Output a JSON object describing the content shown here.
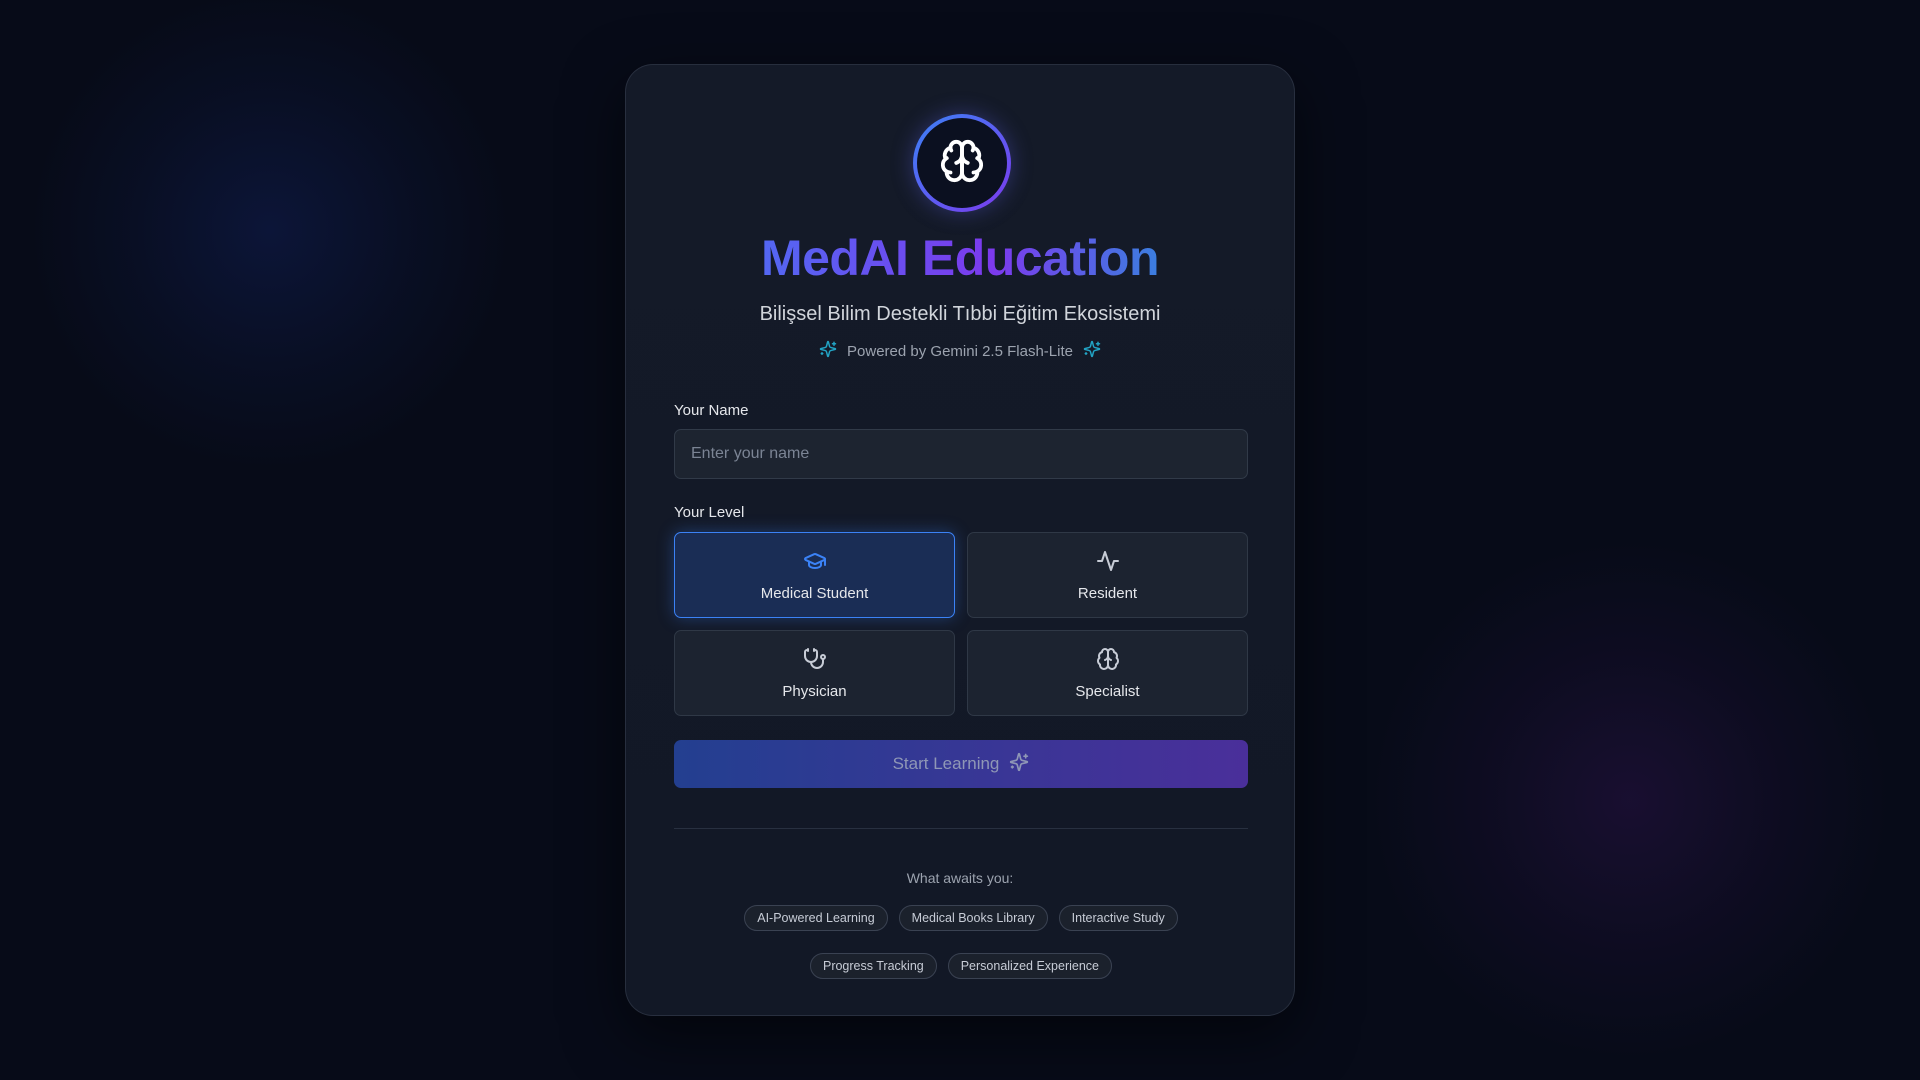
{
  "app": {
    "title": "MedAI Education",
    "subtitle": "Bilişsel Bilim Destekli Tıbbi Eğitim Ekosistemi",
    "powered_by": "Powered by Gemini 2.5 Flash-Lite"
  },
  "form": {
    "name_label": "Your Name",
    "name_placeholder": "Enter your name",
    "name_value": "",
    "level_label": "Your Level",
    "levels": [
      {
        "label": "Medical Student",
        "icon": "graduation-cap-icon",
        "selected": true
      },
      {
        "label": "Resident",
        "icon": "activity-icon",
        "selected": false
      },
      {
        "label": "Physician",
        "icon": "stethoscope-icon",
        "selected": false
      },
      {
        "label": "Specialist",
        "icon": "brain-icon",
        "selected": false
      }
    ],
    "start_label": "Start Learning"
  },
  "features": {
    "heading": "What awaits you:",
    "chips": [
      "AI-Powered Learning",
      "Medical Books Library",
      "Interactive Study",
      "Progress Tracking",
      "Personalized Experience"
    ]
  },
  "colors": {
    "background": "#070b18",
    "accent_blue": "#3b82f6",
    "accent_purple": "#7c3aed",
    "accent_cyan": "#06b6d4"
  }
}
